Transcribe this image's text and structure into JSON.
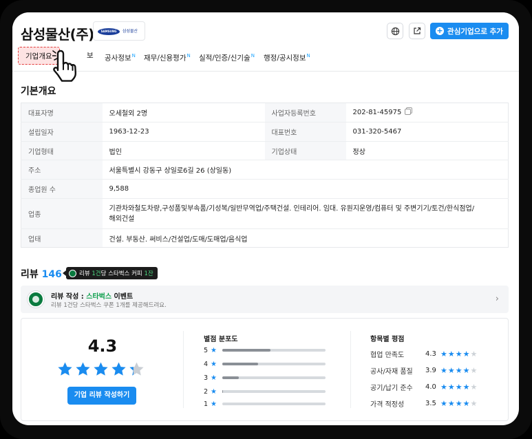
{
  "header": {
    "company_name": "삼성물산(주)",
    "logo_brand": "SAMSUNG",
    "logo_text": "삼성물산",
    "add_interest_label": "관심기업으로 추가"
  },
  "tabs": [
    {
      "label": "기업개요",
      "new": false,
      "active": true
    },
    {
      "label": "보",
      "new": false,
      "active": false
    },
    {
      "label": "공사정보",
      "new": true,
      "active": false
    },
    {
      "label": "재무/신용평가",
      "new": true,
      "active": false
    },
    {
      "label": "실적/인증/신기술",
      "new": true,
      "active": false
    },
    {
      "label": "행정/공시정보",
      "new": true,
      "active": false
    }
  ],
  "new_marker": "N",
  "basic": {
    "title": "기본개요",
    "rows": [
      {
        "l1": "대표자명",
        "v1": "오세철외 2명",
        "l2": "사업자등록번호",
        "v2": "202-81-45975"
      },
      {
        "l1": "설립일자",
        "v1": "1963-12-23",
        "l2": "대표번호",
        "v2": "031-320-5467"
      },
      {
        "l1": "기업형태",
        "v1": "법인",
        "l2": "기업상태",
        "v2": "정상"
      },
      {
        "l1": "주소",
        "v1": "서울특별시 강동구 상일로6길 26 (상일동)"
      },
      {
        "l1": "종업원 수",
        "v1": "9,588"
      },
      {
        "l1": "업종",
        "v1": "기관차와철도차량,구성품및부속품/기성복/일반무역업/주택건설. 인테리어. 임대. 유원지운영/컴퓨터 및 주변기기/토건/한식점업/해외건설"
      },
      {
        "l1": "업태",
        "v1": "건설. 부동산. 써비스/건설업/도매/도매업/음식업"
      }
    ]
  },
  "reviews": {
    "title": "리뷰",
    "count": "146",
    "badge_pre": "리뷰",
    "badge_hl1": "1건",
    "badge_mid": "당 스타벅스 커피",
    "badge_hl2": "1잔",
    "event_title_pre": "리뷰 작성 : ",
    "event_title_hl": "스타벅스",
    "event_title_post": " 이벤트",
    "event_sub": "리뷰 1건당 스타벅스 쿠폰 1개를 제공해드려요.",
    "average": "4.3",
    "average_stars": 4.3,
    "write_label": "기업 리뷰 작성하기",
    "dist_title": "별점 분포도",
    "distribution": [
      {
        "star": "5",
        "ratio": 0.47
      },
      {
        "star": "4",
        "ratio": 0.35
      },
      {
        "star": "3",
        "ratio": 0.16
      },
      {
        "star": "2",
        "ratio": 0.01
      },
      {
        "star": "1",
        "ratio": 0.0
      }
    ],
    "cat_title": "항목별 평점",
    "categories": [
      {
        "label": "협업 만족도",
        "value": "4.3",
        "stars": 4
      },
      {
        "label": "공사/자재 품질",
        "value": "3.9",
        "stars": 4
      },
      {
        "label": "공기/납기 준수",
        "value": "4.0",
        "stars": 4
      },
      {
        "label": "가격 적정성",
        "value": "3.5",
        "stars": 4
      }
    ]
  },
  "colors": {
    "accent": "#1a8cf0",
    "starbucks": "#0a7a3f"
  }
}
